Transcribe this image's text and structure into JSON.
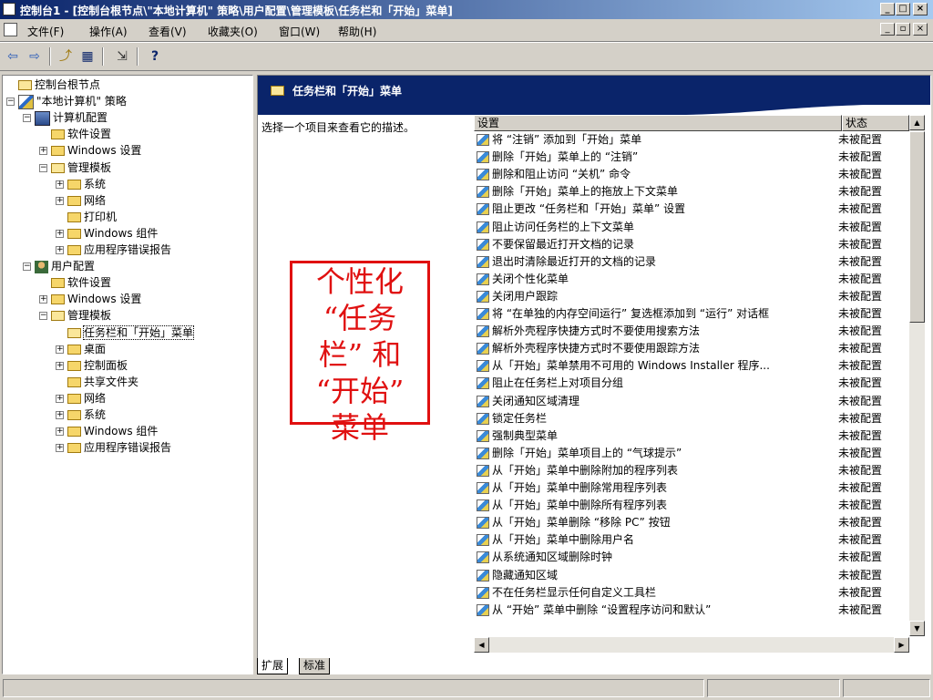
{
  "window": {
    "title": "控制台1 - [控制台根节点\\\"本地计算机\" 策略\\用户配置\\管理模板\\任务栏和「开始」菜单]",
    "controls": [
      "_",
      "□",
      "×"
    ]
  },
  "menu": {
    "items": [
      "文件(F)",
      "操作(A)",
      "查看(V)",
      "收藏夹(O)",
      "窗口(W)",
      "帮助(H)"
    ],
    "mdi_controls": [
      "_",
      "▫",
      "×"
    ]
  },
  "toolbar": {
    "icons": [
      "back-arrow",
      "forward-arrow",
      "up-folder",
      "show-hide-tree",
      "export-list",
      "help"
    ],
    "glyphs": [
      "⇦",
      "⇨",
      "⤴",
      "▦",
      "⇲",
      "?"
    ]
  },
  "tree": [
    {
      "label": "控制台根节点",
      "level": 0,
      "icon": "folder-open",
      "expander": "none"
    },
    {
      "label": "\"本地计算机\" 策略",
      "level": 0,
      "icon": "policy",
      "expander": "minus"
    },
    {
      "label": "计算机配置",
      "level": 1,
      "icon": "computer",
      "expander": "minus"
    },
    {
      "label": "软件设置",
      "level": 2,
      "icon": "folder",
      "expander": "none"
    },
    {
      "label": "Windows 设置",
      "level": 2,
      "icon": "folder",
      "expander": "plus"
    },
    {
      "label": "管理模板",
      "level": 2,
      "icon": "folder-open",
      "expander": "minus"
    },
    {
      "label": "系统",
      "level": 3,
      "icon": "folder",
      "expander": "plus"
    },
    {
      "label": "网络",
      "level": 3,
      "icon": "folder",
      "expander": "plus"
    },
    {
      "label": "打印机",
      "level": 3,
      "icon": "folder",
      "expander": "none"
    },
    {
      "label": "Windows 组件",
      "level": 3,
      "icon": "folder",
      "expander": "plus"
    },
    {
      "label": "应用程序错误报告",
      "level": 3,
      "icon": "folder",
      "expander": "plus"
    },
    {
      "label": "用户配置",
      "level": 1,
      "icon": "user",
      "expander": "minus"
    },
    {
      "label": "软件设置",
      "level": 2,
      "icon": "folder",
      "expander": "none"
    },
    {
      "label": "Windows 设置",
      "level": 2,
      "icon": "folder",
      "expander": "plus"
    },
    {
      "label": "管理模板",
      "level": 2,
      "icon": "folder-open",
      "expander": "minus"
    },
    {
      "label": "任务栏和「开始」菜单",
      "level": 3,
      "icon": "folder-open",
      "expander": "none",
      "selected": true
    },
    {
      "label": "桌面",
      "level": 3,
      "icon": "folder",
      "expander": "plus"
    },
    {
      "label": "控制面板",
      "level": 3,
      "icon": "folder",
      "expander": "plus"
    },
    {
      "label": "共享文件夹",
      "level": 3,
      "icon": "folder",
      "expander": "none"
    },
    {
      "label": "网络",
      "level": 3,
      "icon": "folder",
      "expander": "plus"
    },
    {
      "label": "系统",
      "level": 3,
      "icon": "folder",
      "expander": "plus"
    },
    {
      "label": "Windows 组件",
      "level": 3,
      "icon": "folder",
      "expander": "plus"
    },
    {
      "label": "应用程序错误报告",
      "level": 3,
      "icon": "folder",
      "expander": "plus"
    }
  ],
  "right": {
    "header": "任务栏和「开始」菜单",
    "description": "选择一个项目来查看它的描述。",
    "columns": {
      "setting": "设置",
      "state": "状态"
    },
    "rows": [
      {
        "setting": "将 “注销” 添加到「开始」菜单",
        "state": "未被配置"
      },
      {
        "setting": "删除「开始」菜单上的 “注销”",
        "state": "未被配置"
      },
      {
        "setting": "删除和阻止访问 “关机” 命令",
        "state": "未被配置"
      },
      {
        "setting": "删除「开始」菜单上的拖放上下文菜单",
        "state": "未被配置"
      },
      {
        "setting": "阻止更改 “任务栏和「开始」菜单” 设置",
        "state": "未被配置"
      },
      {
        "setting": "阻止访问任务栏的上下文菜单",
        "state": "未被配置"
      },
      {
        "setting": "不要保留最近打开文档的记录",
        "state": "未被配置"
      },
      {
        "setting": "退出时清除最近打开的文档的记录",
        "state": "未被配置"
      },
      {
        "setting": "关闭个性化菜单",
        "state": "未被配置"
      },
      {
        "setting": "关闭用户跟踪",
        "state": "未被配置"
      },
      {
        "setting": "将 “在单独的内存空间运行” 复选框添加到 “运行” 对话框",
        "state": "未被配置"
      },
      {
        "setting": "解析外壳程序快捷方式时不要使用搜索方法",
        "state": "未被配置"
      },
      {
        "setting": "解析外壳程序快捷方式时不要使用跟踪方法",
        "state": "未被配置"
      },
      {
        "setting": "从「开始」菜单禁用不可用的 Windows Installer 程序...",
        "state": "未被配置"
      },
      {
        "setting": "阻止在任务栏上对项目分组",
        "state": "未被配置"
      },
      {
        "setting": "关闭通知区域清理",
        "state": "未被配置"
      },
      {
        "setting": "锁定任务栏",
        "state": "未被配置"
      },
      {
        "setting": "强制典型菜单",
        "state": "未被配置"
      },
      {
        "setting": "删除「开始」菜单项目上的 “气球提示”",
        "state": "未被配置"
      },
      {
        "setting": "从「开始」菜单中删除附加的程序列表",
        "state": "未被配置"
      },
      {
        "setting": "从「开始」菜单中删除常用程序列表",
        "state": "未被配置"
      },
      {
        "setting": "从「开始」菜单中删除所有程序列表",
        "state": "未被配置"
      },
      {
        "setting": "从「开始」菜单删除 “移除 PC” 按钮",
        "state": "未被配置"
      },
      {
        "setting": "从「开始」菜单中删除用户名",
        "state": "未被配置"
      },
      {
        "setting": "从系统通知区域删除时钟",
        "state": "未被配置"
      },
      {
        "setting": "隐藏通知区域",
        "state": "未被配置"
      },
      {
        "setting": "不在任务栏显示任何自定义工具栏",
        "state": "未被配置"
      },
      {
        "setting": "从 “开始” 菜单中删除 “设置程序访问和默认”",
        "state": "未被配置"
      }
    ]
  },
  "tabs": [
    "扩展",
    "标准"
  ],
  "annotation": {
    "lines": [
      "个性化",
      "“任务",
      "栏” 和",
      "“开始”",
      "菜单"
    ],
    "color": "#e01010"
  }
}
